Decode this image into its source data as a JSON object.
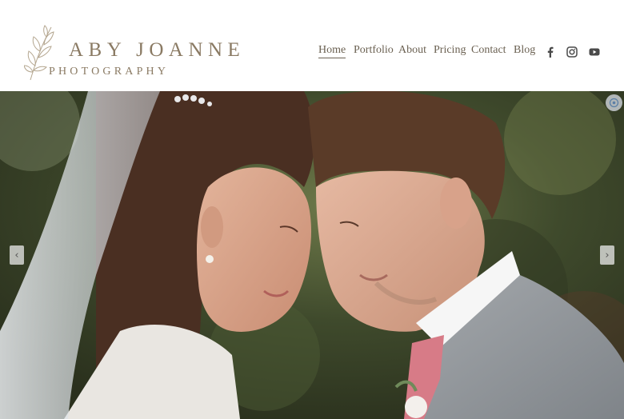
{
  "brand": {
    "name": "ABY JOANNE",
    "tagline": "PHOTOGRAPHY",
    "color": "#8a7a63"
  },
  "nav": {
    "items": [
      {
        "label": "Home",
        "active": true
      },
      {
        "label": "Portfolio"
      },
      {
        "label": "About"
      },
      {
        "label": "Pricing"
      },
      {
        "label": "Contact"
      },
      {
        "label": "Blog"
      }
    ],
    "text_color": "#6b6152"
  },
  "social": [
    "facebook-icon",
    "instagram-icon",
    "youtube-icon"
  ],
  "hero": {
    "arrows": {
      "prev": "‹",
      "next": "›"
    }
  }
}
